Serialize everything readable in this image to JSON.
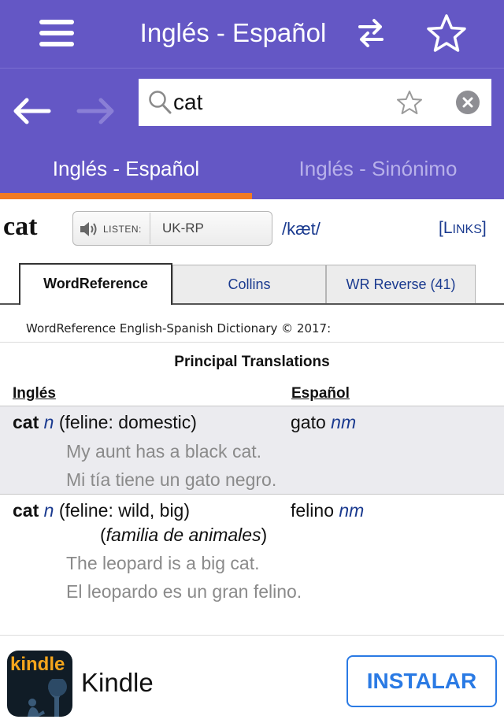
{
  "header": {
    "title": "Inglés - Español",
    "menu_icon": "hamburger-menu-icon",
    "swap_icon": "swap-arrows-icon",
    "favorite_icon": "star-outline-icon",
    "color": "#6457c5"
  },
  "search": {
    "value": "cat",
    "placeholder": "",
    "back_icon": "arrow-left-icon",
    "forward_icon": "arrow-right-icon",
    "search_icon": "magnifier-icon",
    "star_icon": "star-outline-icon",
    "clear_icon": "clear-x-icon"
  },
  "tabs": [
    {
      "label": "Inglés - Español",
      "active": true
    },
    {
      "label": "Inglés - Sinónimo",
      "active": false
    }
  ],
  "accent_color": "#f27a22",
  "entry": {
    "headword": "cat",
    "listen_label": "LISTEN:",
    "accent_option": "UK-RP",
    "phonetic": "/kæt/",
    "links_bracket_open": "[",
    "links_first": "L",
    "links_rest": "INKS",
    "links_bracket_close": "]"
  },
  "dictionary_tabs": [
    {
      "label": "WordReference",
      "active": true
    },
    {
      "label": "Collins",
      "active": false
    },
    {
      "label": "WR Reverse (41)",
      "active": false
    }
  ],
  "dictionary": {
    "copyright": "WordReference English-Spanish Dictionary © 2017:",
    "section_title": "Principal Translations",
    "col_source": "Inglés",
    "col_target": "Español",
    "rows": [
      {
        "term": "cat",
        "pos": "n",
        "sense": "(feline: domestic)",
        "translation": "gato",
        "translation_pos": "nm",
        "note_open": "",
        "note": "",
        "note_close": "",
        "example_en": "My aunt has a black cat.",
        "example_es": "Mi tía tiene un gato negro."
      },
      {
        "term": "cat",
        "pos": "n",
        "sense": "(feline: wild, big)",
        "translation": "felino",
        "translation_pos": "nm",
        "note_open": "(",
        "note": "familia de animales",
        "note_close": ")",
        "example_en": "The leopard is a big cat.",
        "example_es": "El leopardo es un gran felino."
      }
    ]
  },
  "ad": {
    "logo_text": "kindle",
    "title": "Kindle",
    "button_label": "INSTALAR",
    "button_color": "#2a7ae4"
  }
}
